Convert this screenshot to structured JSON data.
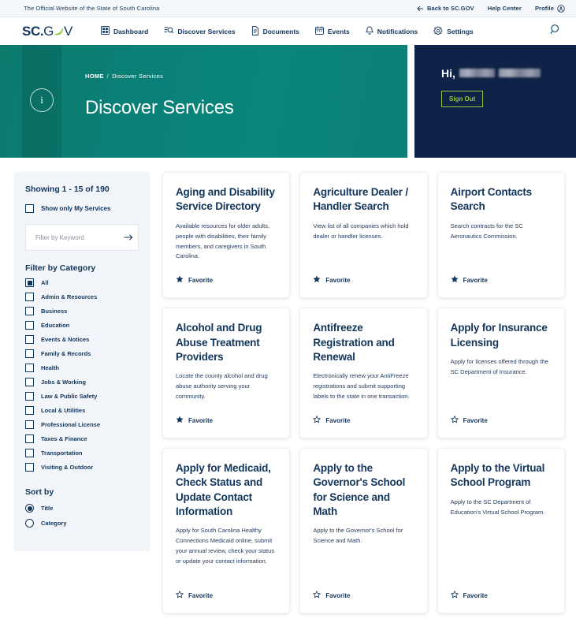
{
  "utility_bar": {
    "tagline": "The Official Website of the State of South Carolina",
    "back_label": "Back to SC.GOV",
    "help_label": "Help Center",
    "profile_label": "Profile"
  },
  "brand": {
    "logo_sc": "SC",
    "logo_dot": ".",
    "logo_g": "G",
    "logo_v": "V"
  },
  "nav": {
    "items": [
      {
        "label": "Dashboard",
        "icon": "grid-icon"
      },
      {
        "label": "Discover Services",
        "icon": "list-search-icon"
      },
      {
        "label": "Documents",
        "icon": "document-icon"
      },
      {
        "label": "Events",
        "icon": "calendar-icon"
      },
      {
        "label": "Notifications",
        "icon": "bell-icon"
      },
      {
        "label": "Settings",
        "icon": "gear-icon"
      }
    ],
    "search_icon": "search-icon"
  },
  "hero": {
    "breadcrumb_home": "HOME",
    "breadcrumb_sep": "/",
    "breadcrumb_current": "Discover Services",
    "title": "Discover Services",
    "info_icon": "info-icon",
    "accent_color": "#0a8077"
  },
  "user_panel": {
    "greeting": "Hi,",
    "name_redacted": true,
    "signout_label": "Sign Out",
    "background_color": "#0e2347",
    "signout_color": "#8dc63f"
  },
  "sidebar": {
    "showing": "Showing 1 - 15 of 190",
    "my_services_label": "Show only My Services",
    "my_services_checked": false,
    "keyword_placeholder": "Filter by Keyword",
    "keyword_value": "",
    "filter_title": "Filter by Category",
    "categories": [
      {
        "label": "All",
        "checked": true
      },
      {
        "label": "Admin & Resources",
        "checked": false
      },
      {
        "label": "Business",
        "checked": false
      },
      {
        "label": "Education",
        "checked": false
      },
      {
        "label": "Events & Notices",
        "checked": false
      },
      {
        "label": "Family & Records",
        "checked": false
      },
      {
        "label": "Health",
        "checked": false
      },
      {
        "label": "Jobs & Working",
        "checked": false
      },
      {
        "label": "Law & Public Safety",
        "checked": false
      },
      {
        "label": "Local & Utilities",
        "checked": false
      },
      {
        "label": "Professional License",
        "checked": false
      },
      {
        "label": "Taxes & Finance",
        "checked": false
      },
      {
        "label": "Transportation",
        "checked": false
      },
      {
        "label": "Visiting & Outdoor",
        "checked": false
      }
    ],
    "sort_title": "Sort by",
    "sort_options": [
      {
        "label": "Title",
        "selected": true
      },
      {
        "label": "Category",
        "selected": false
      }
    ]
  },
  "favorite_label": "Favorite",
  "cards": [
    {
      "title": "Aging and Disability Service Directory",
      "desc": "Available resources for older adults, people with disabilities, their family members, and caregivers in South Carolina.",
      "favorite": true
    },
    {
      "title": "Agriculture Dealer / Handler Search",
      "desc": "View list of all companies which hold dealer or handler licenses.",
      "favorite": true
    },
    {
      "title": "Airport Contacts Search",
      "desc": "Search contracts for the SC Aeronautics Commission.",
      "favorite": true
    },
    {
      "title": "Alcohol and Drug Abuse Treatment Providers",
      "desc": "Locate the county alcohol and drug abuse authority serving your community.",
      "favorite": true
    },
    {
      "title": "Antifreeze Registration and Renewal",
      "desc": "Electronically renew your AntiFreeze registrations and submit supporting labels to the state in one transaction.",
      "favorite": false
    },
    {
      "title": "Apply for Insurance Licensing",
      "desc": "Apply for licenses offered through the SC Department of Insurance.",
      "favorite": false
    },
    {
      "title": "Apply for Medicaid, Check Status and Update Contact Information",
      "desc": "Apply for South Carolina Healthy Connections Medicaid online, submit your annual review, check your status or update your contact information.",
      "favorite": false
    },
    {
      "title": "Apply to the Governor's School for Science and Math",
      "desc": "Apply to the Governor's School for Science and Math.",
      "favorite": false
    },
    {
      "title": "Apply to the Virtual School Program",
      "desc": "Apply to the SC Department of Education's Virtual School Program.",
      "favorite": false
    }
  ]
}
